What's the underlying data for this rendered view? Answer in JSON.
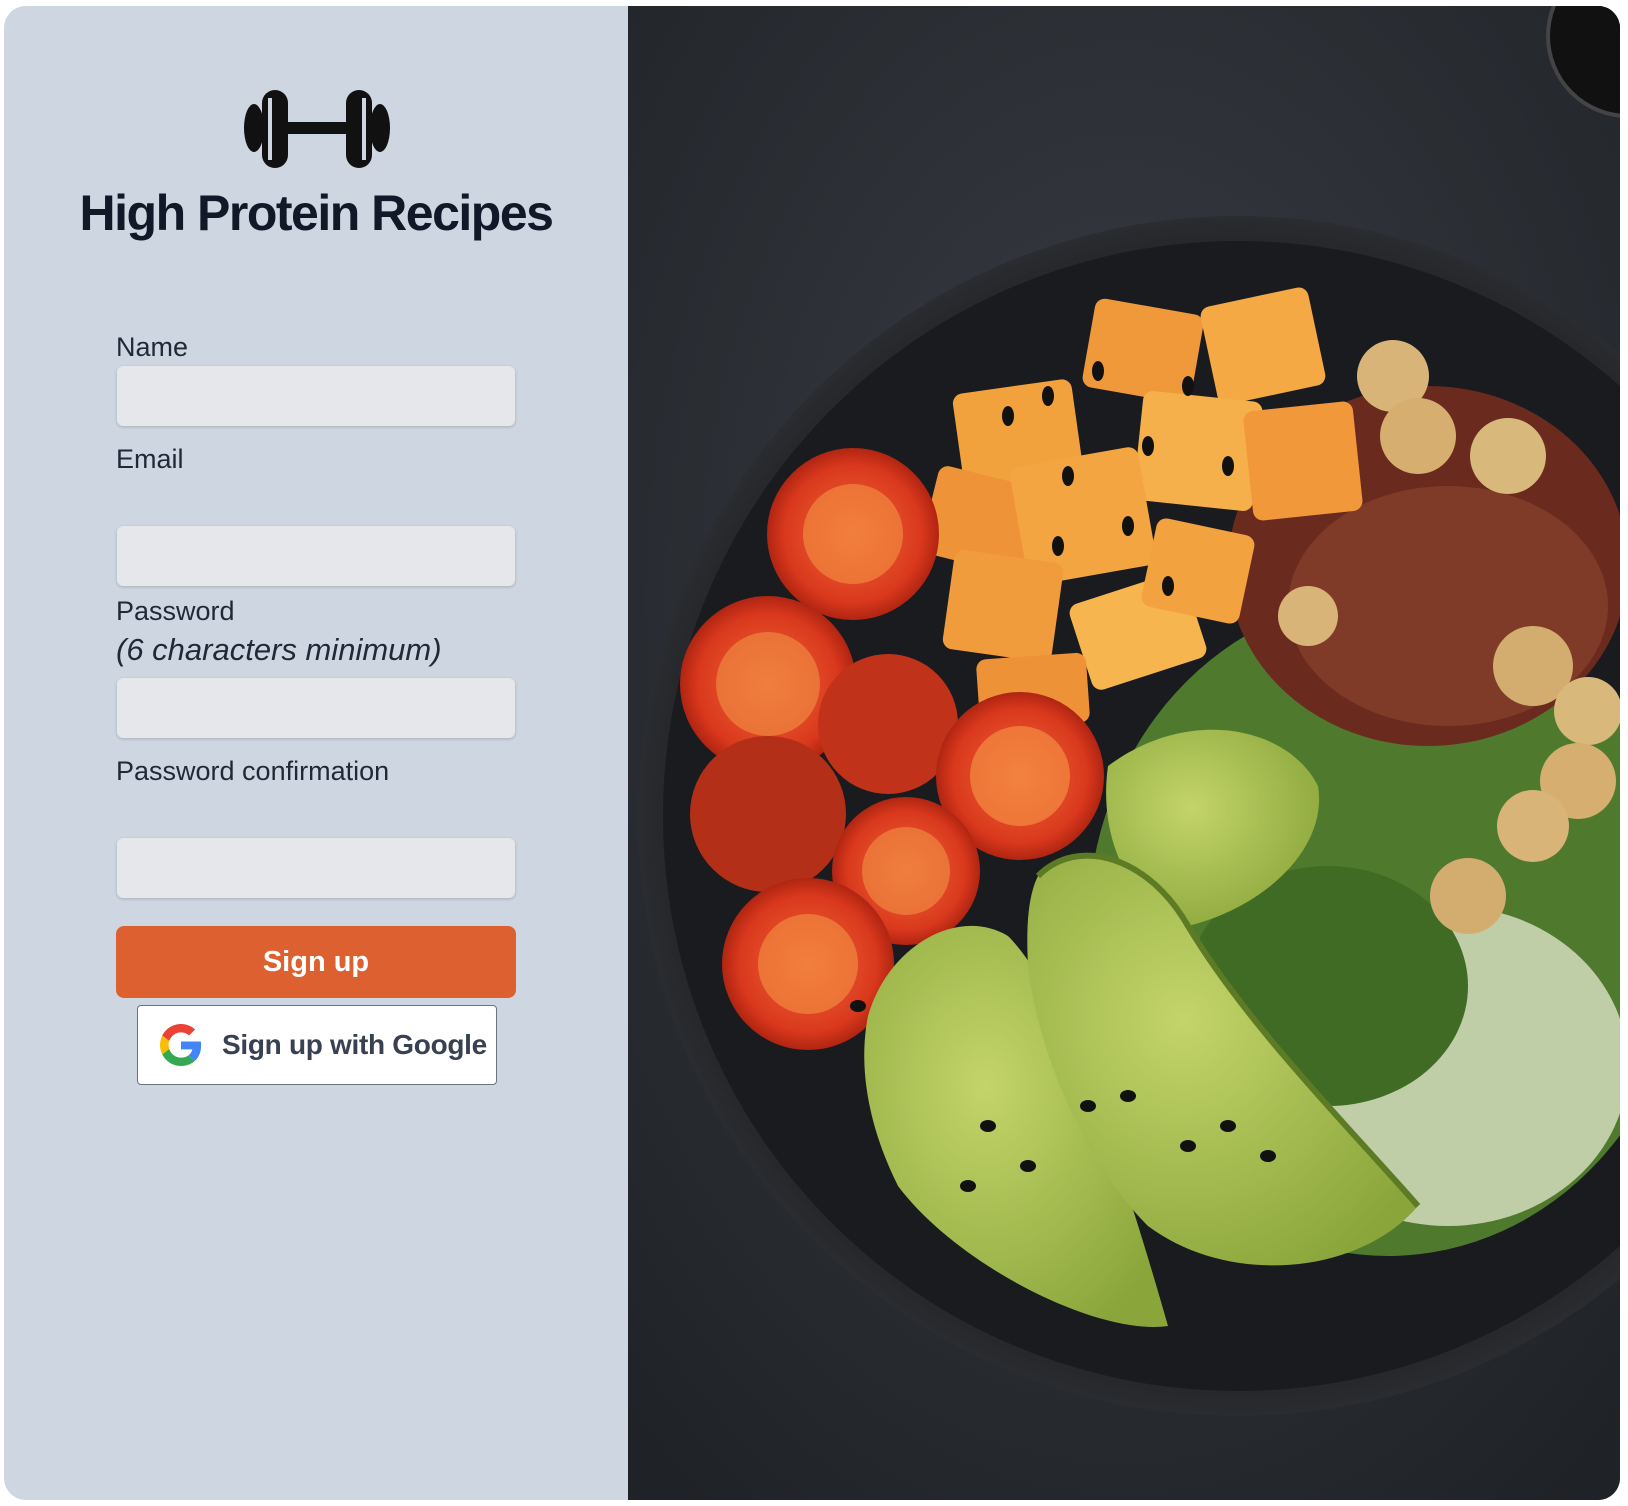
{
  "app": {
    "title": "High Protein Recipes",
    "logo_icon": "dumbbell-icon"
  },
  "form": {
    "name_label": "Name",
    "email_label": "Email",
    "password_label": "Password",
    "password_hint": "(6 characters minimum)",
    "password_confirmation_label": "Password confirmation",
    "name_value": "",
    "email_value": "",
    "password_value": "",
    "password_confirmation_value": "",
    "submit_label": "Sign up",
    "google_label": "Sign up with Google",
    "google_icon": "google-g-icon"
  },
  "colors": {
    "panel_bg": "#cdd6e1",
    "primary": "#dd6130",
    "input_bg": "#e5e7eb",
    "title": "#111827"
  },
  "hero_image": {
    "icon": "salad-bowl-photo"
  }
}
